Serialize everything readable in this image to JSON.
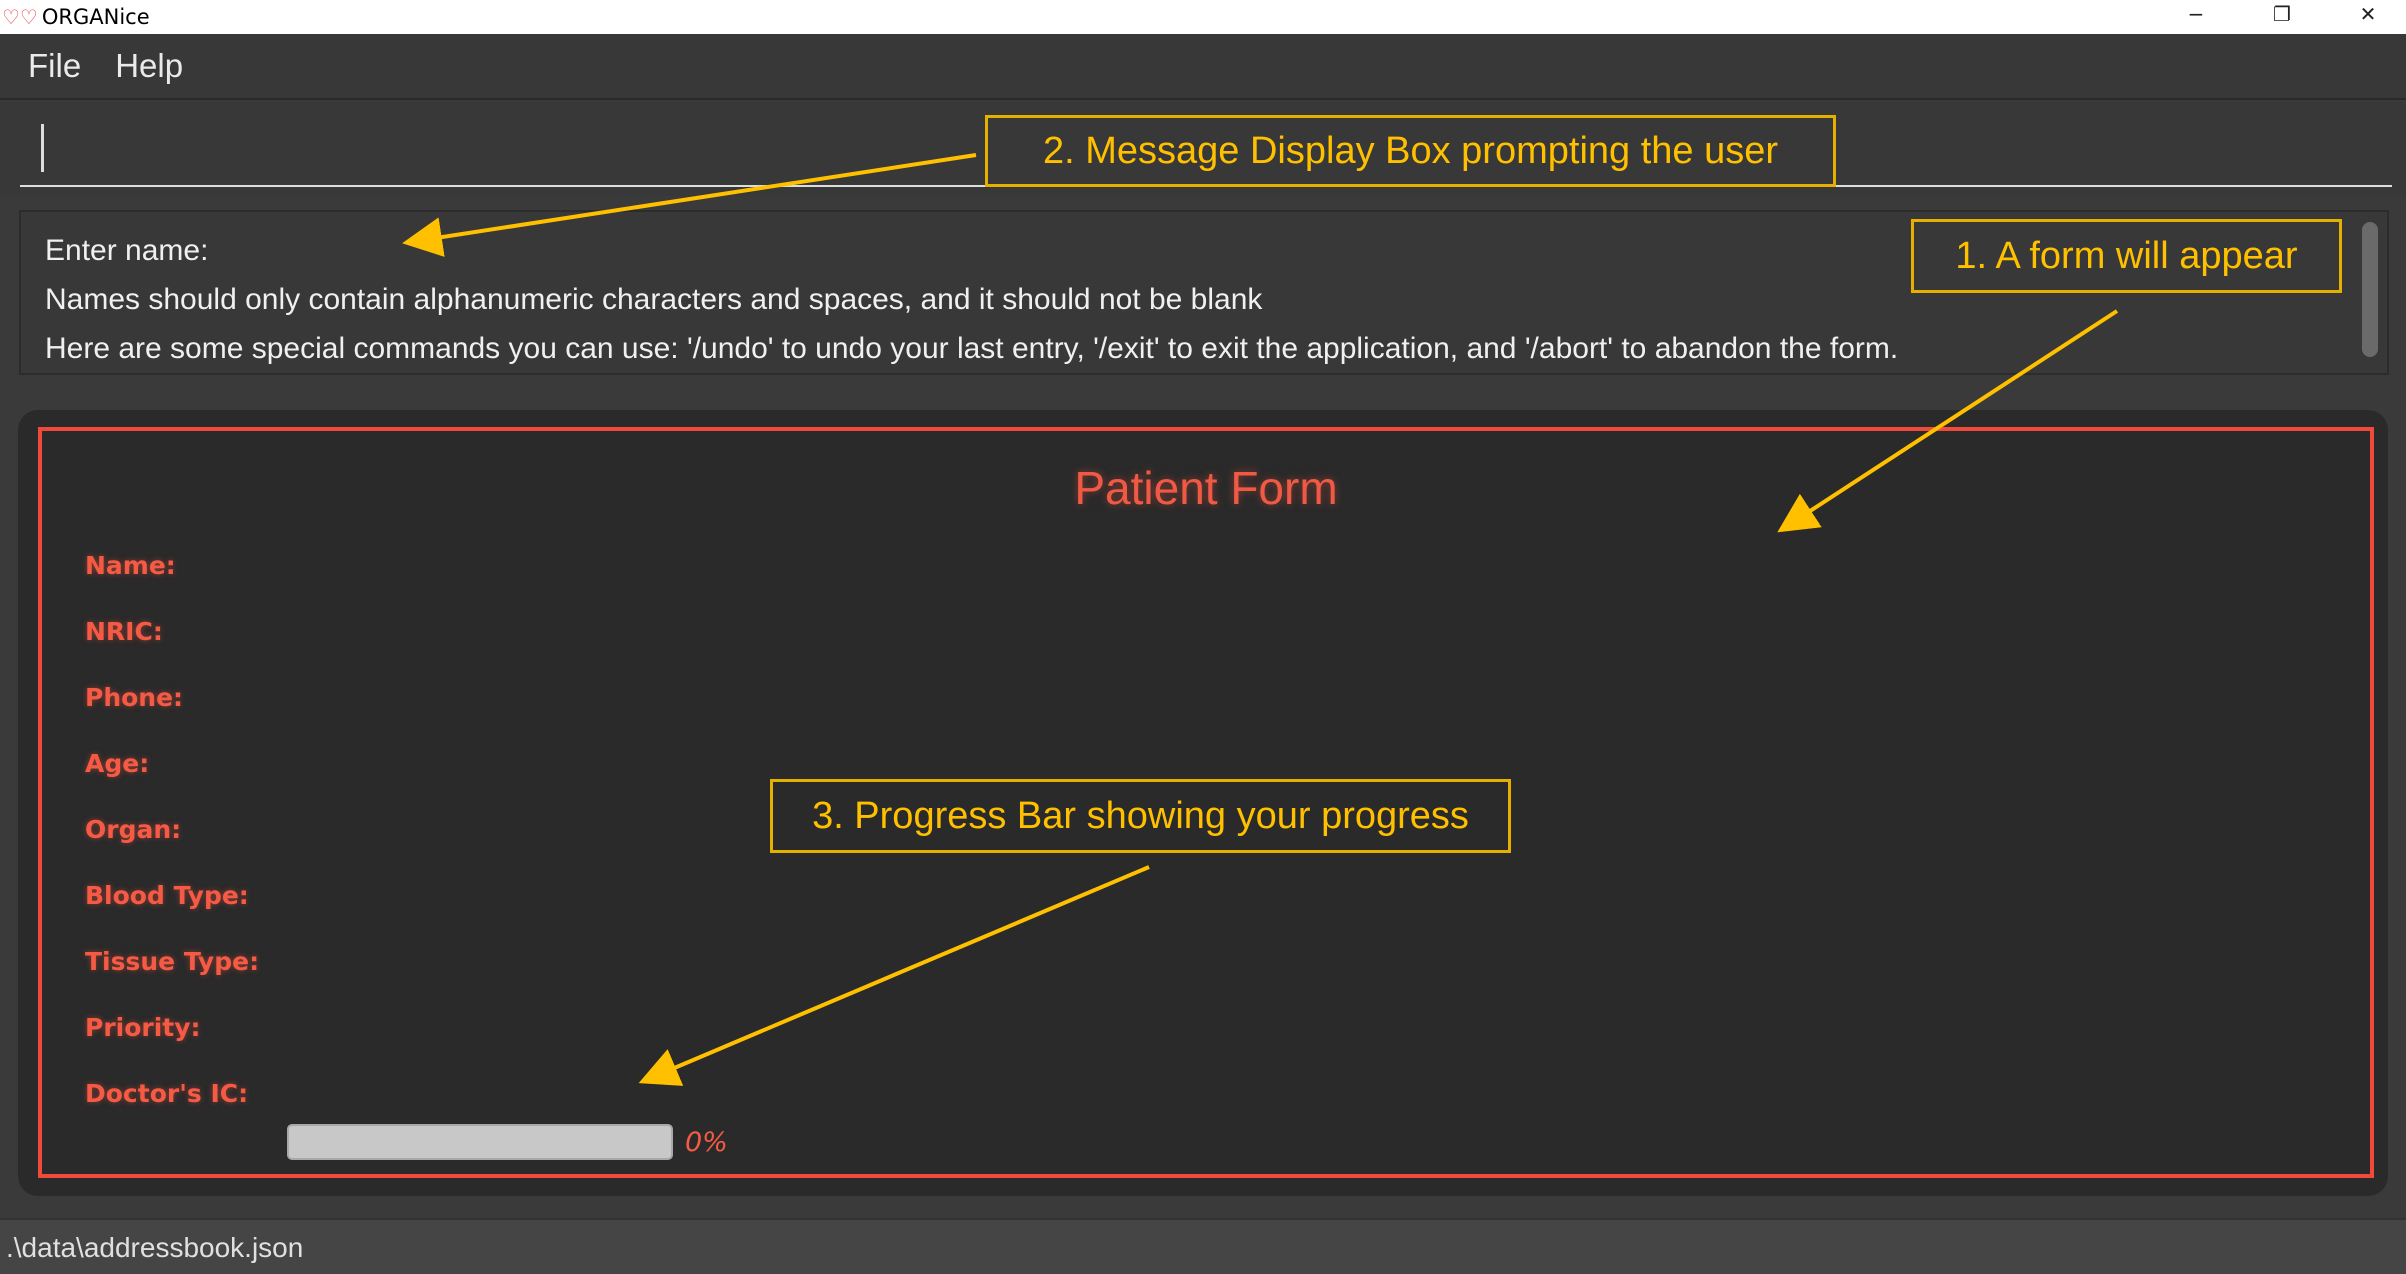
{
  "window": {
    "title": "ORGANice",
    "logo_icon": "hearts-icon",
    "controls": [
      "minimize",
      "restore",
      "close"
    ]
  },
  "menu": {
    "items": [
      "File",
      "Help"
    ]
  },
  "command_box": {
    "value": ""
  },
  "message_box": {
    "lines": [
      "Enter name:",
      "Names should only contain alphanumeric characters and spaces, and it should not be blank",
      "Here are some special commands you can use: '/undo' to undo your last entry, '/exit' to exit the application, and '/abort' to abandon the form."
    ]
  },
  "form": {
    "title": "Patient Form",
    "labels": [
      "Name:",
      "NRIC:",
      "Phone:",
      "Age:",
      "Organ:",
      "Blood Type:",
      "Tissue Type:",
      "Priority:",
      "Doctor's IC:"
    ],
    "progress_percent": 0,
    "progress_label": "0%",
    "accent": "#f04a3a"
  },
  "status_bar": {
    "path": ".\\data\\addressbook.json"
  },
  "annotations": {
    "color": "#ffc000",
    "items": [
      "1. A form will appear",
      "2. Message Display Box prompting the user",
      "3. Progress Bar showing your progress"
    ]
  }
}
